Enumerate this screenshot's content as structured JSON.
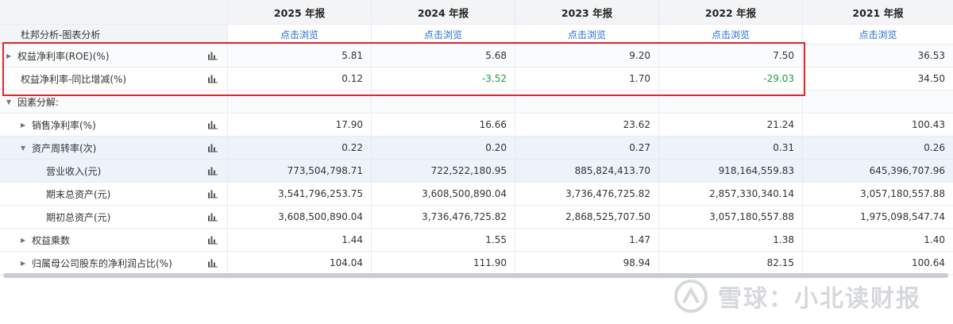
{
  "header": {
    "years": [
      "2025 年报",
      "2024 年报",
      "2023 年报",
      "2022 年报",
      "2021 年报"
    ]
  },
  "subheader": {
    "label": "杜邦分析-图表分析",
    "link_text": "点击浏览"
  },
  "rows": [
    {
      "label": "权益净利率(ROE)(%)",
      "values": [
        "5.81",
        "5.68",
        "9.20",
        "7.50",
        "36.53"
      ]
    },
    {
      "label": "权益净利率-同比增减(%)",
      "values": [
        "0.12",
        "-3.52",
        "1.70",
        "-29.03",
        "34.50"
      ]
    },
    {
      "label": "因素分解:"
    },
    {
      "label": "销售净利率(%)",
      "values": [
        "17.90",
        "16.66",
        "23.62",
        "21.24",
        "100.43"
      ]
    },
    {
      "label": "资产周转率(次)",
      "values": [
        "0.22",
        "0.20",
        "0.27",
        "0.31",
        "0.26"
      ]
    },
    {
      "label": "营业收入(元)",
      "values": [
        "773,504,798.71",
        "722,522,180.95",
        "885,824,413.70",
        "918,164,559.83",
        "645,396,707.96"
      ]
    },
    {
      "label": "期末总资产(元)",
      "values": [
        "3,541,796,253.75",
        "3,608,500,890.04",
        "3,736,476,725.82",
        "2,857,330,340.14",
        "3,057,180,557.88"
      ]
    },
    {
      "label": "期初总资产(元)",
      "values": [
        "3,608,500,890.04",
        "3,736,476,725.82",
        "2,868,525,707.50",
        "3,057,180,557.88",
        "1,975,098,547.74"
      ]
    },
    {
      "label": "权益乘数",
      "values": [
        "1.44",
        "1.55",
        "1.47",
        "1.38",
        "1.40"
      ]
    },
    {
      "label": "归属母公司股东的净利润占比(%)",
      "values": [
        "104.04",
        "111.90",
        "98.94",
        "82.15",
        "100.64"
      ]
    }
  ],
  "watermark": "雪球：小北读财报",
  "colors": {
    "link": "#2a6ed0",
    "negative": "#1f9d3a",
    "highlight_box": "#e0262b"
  }
}
